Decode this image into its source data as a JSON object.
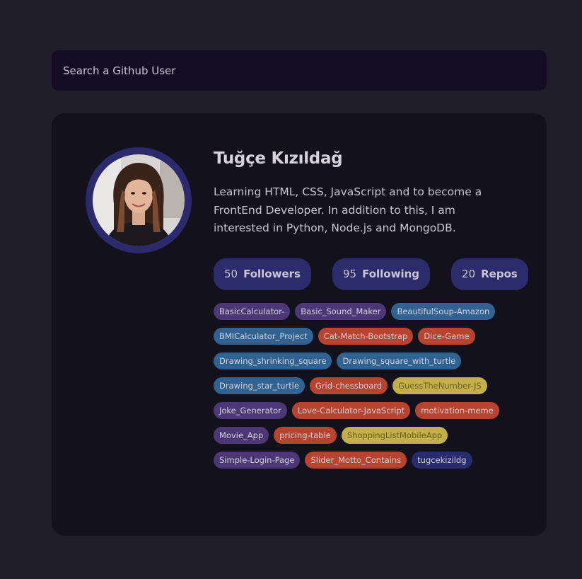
{
  "search": {
    "placeholder": "Search a Github User"
  },
  "profile": {
    "name": "Tuğçe Kızıldağ",
    "bio": "Learning HTML, CSS, JavaScript and to become a FrontEnd Developer. In addition to this, I am interested in Python, Node.js and MongoDB.",
    "avatar_icon": "user-avatar-photo"
  },
  "stats": [
    {
      "value": "50",
      "label": "Followers"
    },
    {
      "value": "95",
      "label": "Following"
    },
    {
      "value": "20",
      "label": "Repos"
    }
  ],
  "repos": [
    {
      "name": "BasicCalculator-",
      "color": "purple"
    },
    {
      "name": "Basic_Sound_Maker",
      "color": "purple"
    },
    {
      "name": "BeautifulSoup-Amazon",
      "color": "blue"
    },
    {
      "name": "BMICalculator_Project",
      "color": "blue"
    },
    {
      "name": "Cat-Match-Bootstrap",
      "color": "red"
    },
    {
      "name": "Dice-Game",
      "color": "red"
    },
    {
      "name": "Drawing_shrinking_square",
      "color": "blue"
    },
    {
      "name": "Drawing_square_with_turtle",
      "color": "blue"
    },
    {
      "name": "Drawing_star_turtle",
      "color": "blue"
    },
    {
      "name": "Grid-chessboard",
      "color": "red"
    },
    {
      "name": "GuessTheNumber-JS",
      "color": "yellow"
    },
    {
      "name": "Joke_Generator",
      "color": "purple"
    },
    {
      "name": "Love-Calculator-JavaScript",
      "color": "red"
    },
    {
      "name": "motivation-meme",
      "color": "red"
    },
    {
      "name": "Movie_App",
      "color": "purple"
    },
    {
      "name": "pricing-table",
      "color": "red"
    },
    {
      "name": "ShoppingListMobileApp",
      "color": "yellow"
    },
    {
      "name": "Simple-Login-Page",
      "color": "purple"
    },
    {
      "name": "Slider_Motto_Contains",
      "color": "red"
    },
    {
      "name": "tugcekizildg",
      "color": "navy"
    }
  ],
  "colors": {
    "page_bg": "#1f1e2a",
    "card_bg": "#13111c",
    "search_bg": "#140c22",
    "accent": "#2c2b6b",
    "repo_purple": "#4d3877",
    "repo_blue": "#306292",
    "repo_red": "#b8442f",
    "repo_yellow": "#c3b04b",
    "repo_navy": "#292b70"
  }
}
